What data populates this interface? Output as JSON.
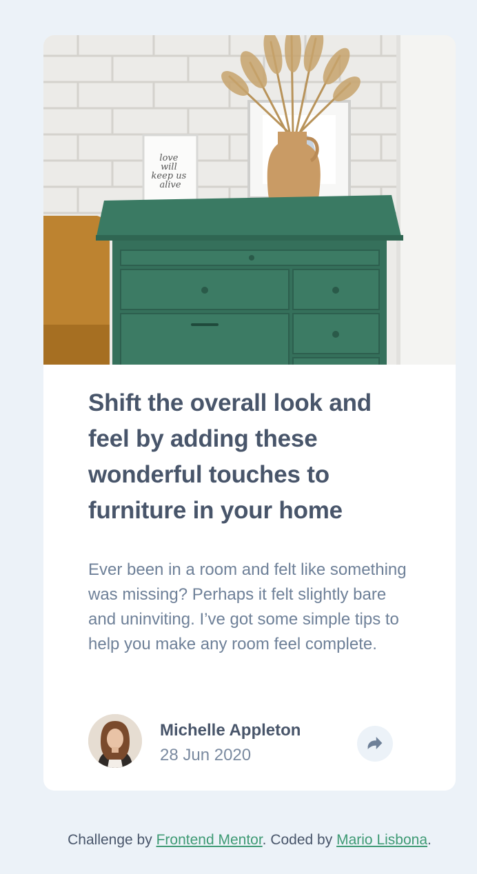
{
  "article": {
    "hero_image": "drawers-image",
    "frame_text": [
      "love",
      "will",
      "keep us",
      "alive"
    ],
    "title": "Shift the overall look and feel by adding these wonderful touches to furniture in your home",
    "excerpt": "Ever been in a room and felt like something was missing? Perhaps it felt slightly bare and uninviting. I’ve got some simple tips to help you make any room feel complete."
  },
  "author": {
    "name": "Michelle Appleton",
    "date": "28 Jun 2020",
    "avatar": "avatar-michelle"
  },
  "share": {
    "icon": "share-icon"
  },
  "attribution": {
    "challenge_prefix": "Challenge by",
    "challenge_link": "Frontend Mentor",
    "coded_prefix": ". Coded by",
    "coded_link": "Mario Lisbona",
    "suffix": "."
  },
  "colors": {
    "background": "#ecf2f8",
    "heading": "#48556a",
    "body_text": "#6e8098",
    "link": "#3e9a74",
    "dresser": "#36705b"
  }
}
